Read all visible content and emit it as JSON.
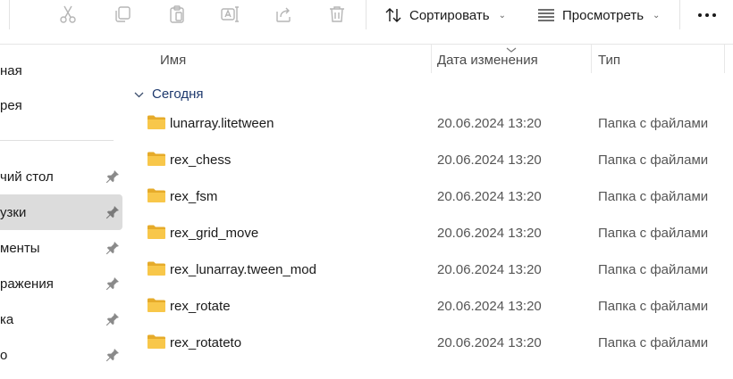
{
  "toolbar": {
    "sort_label": "Сортировать",
    "view_label": "Просмотреть",
    "icons": [
      "cut-icon",
      "copy-icon",
      "paste-icon",
      "rename-icon",
      "share-icon",
      "delete-icon",
      "sort-icon",
      "view-icon",
      "more-icon"
    ]
  },
  "sidebar": {
    "items": [
      {
        "label": "ная",
        "pinned": false,
        "active": false
      },
      {
        "label": "рея",
        "pinned": false,
        "active": false
      },
      {
        "label": "чий стол",
        "pinned": true,
        "active": false
      },
      {
        "label": "узки",
        "pinned": true,
        "active": true
      },
      {
        "label": "менты",
        "pinned": true,
        "active": false
      },
      {
        "label": "ражения",
        "pinned": true,
        "active": false
      },
      {
        "label": "ка",
        "pinned": true,
        "active": false
      },
      {
        "label": "о",
        "pinned": true,
        "active": false
      }
    ]
  },
  "columns": {
    "name": "Имя",
    "date": "Дата изменения",
    "type": "Тип"
  },
  "group": {
    "label": "Сегодня"
  },
  "files": [
    {
      "name": "lunarray.litetween",
      "date": "20.06.2024 13:20",
      "type": "Папка с файлами"
    },
    {
      "name": "rex_chess",
      "date": "20.06.2024 13:20",
      "type": "Папка с файлами"
    },
    {
      "name": "rex_fsm",
      "date": "20.06.2024 13:20",
      "type": "Папка с файлами"
    },
    {
      "name": "rex_grid_move",
      "date": "20.06.2024 13:20",
      "type": "Папка с файлами"
    },
    {
      "name": "rex_lunarray.tween_mod",
      "date": "20.06.2024 13:20",
      "type": "Папка с файлами"
    },
    {
      "name": "rex_rotate",
      "date": "20.06.2024 13:20",
      "type": "Папка с файлами"
    },
    {
      "name": "rex_rotateto",
      "date": "20.06.2024 13:20",
      "type": "Папка с файлами"
    }
  ],
  "colors": {
    "folder": "#f8c74a",
    "folder_dark": "#e6ab2a",
    "group_text": "#1f3a6e",
    "active_nav": "#dcdcdc"
  }
}
